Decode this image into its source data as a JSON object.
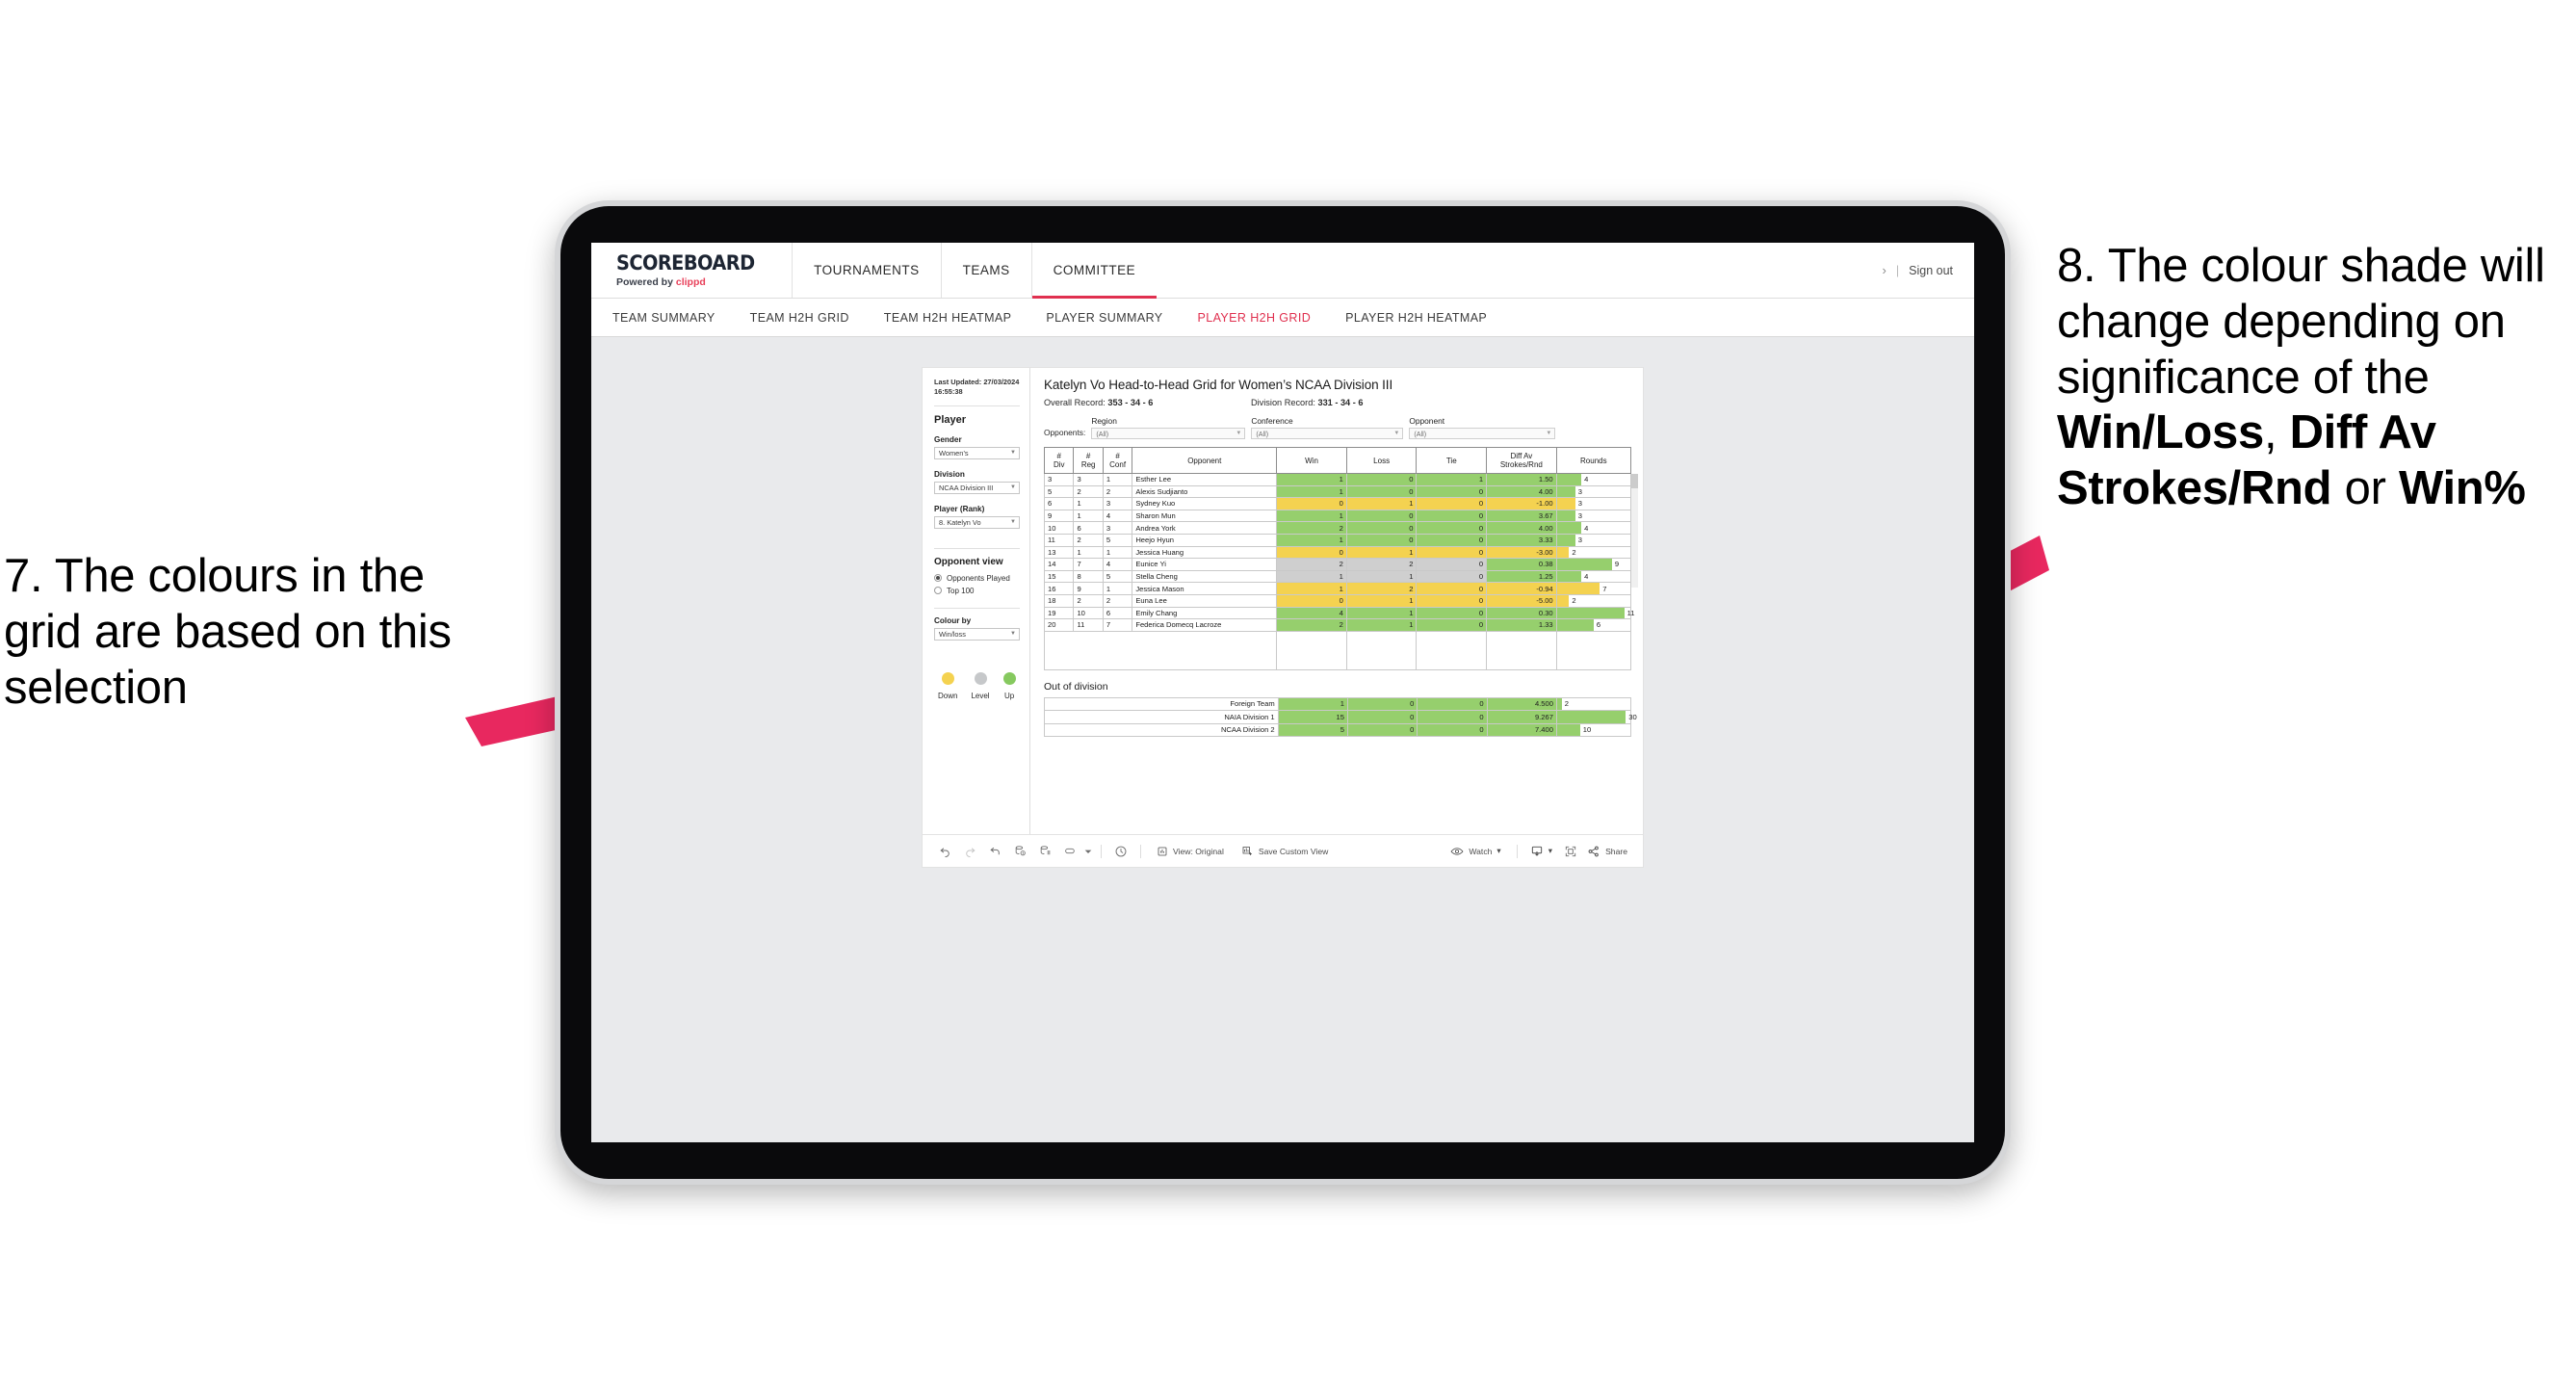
{
  "annotations": {
    "left": "7. The colours in the grid are based on this selection",
    "right_pre": "8. The colour shade will change depending on significance of the ",
    "right_b1": "Win/Loss",
    "right_mid1": ", ",
    "right_b2": "Diff Av Strokes/Rnd",
    "right_mid2": " or ",
    "right_b3": "Win%",
    "arrow_color": "#e8285f"
  },
  "header": {
    "brand_name": "SCOREBOARD",
    "brand_sub_prefix": "Powered by ",
    "brand_sub_clippd": "clippd",
    "tabs": [
      {
        "label": "TOURNAMENTS",
        "active": false
      },
      {
        "label": "TEAMS",
        "active": false
      },
      {
        "label": "COMMITTEE",
        "active": true
      }
    ],
    "chevron": "›",
    "separator": "|",
    "sign_out": "Sign out"
  },
  "subnav": {
    "items": [
      {
        "label": "TEAM SUMMARY",
        "active": false
      },
      {
        "label": "TEAM H2H GRID",
        "active": false
      },
      {
        "label": "TEAM H2H HEATMAP",
        "active": false
      },
      {
        "label": "PLAYER SUMMARY",
        "active": false
      },
      {
        "label": "PLAYER H2H GRID",
        "active": true
      },
      {
        "label": "PLAYER H2H HEATMAP",
        "active": false
      }
    ],
    "active_color": "#e0304f"
  },
  "panel": {
    "last_updated_line1": "Last Updated: 27/03/2024",
    "last_updated_line2": "16:55:38",
    "section_player": "Player",
    "fields": [
      {
        "label": "Gender",
        "value": "Women’s"
      },
      {
        "label": "Division",
        "value": "NCAA Division III"
      },
      {
        "label": "Player (Rank)",
        "value": "8. Katelyn Vo"
      }
    ],
    "opponent_view_title": "Opponent view",
    "opponent_view_options": [
      {
        "label": "Opponents Played",
        "selected": true
      },
      {
        "label": "Top 100",
        "selected": false
      }
    ],
    "colour_by_label": "Colour by",
    "colour_by_value": "Win/loss",
    "legend": [
      {
        "label": "Down",
        "color": "#f4d250"
      },
      {
        "label": "Level",
        "color": "#c6c8ca"
      },
      {
        "label": "Up",
        "color": "#86c95f"
      }
    ]
  },
  "main": {
    "title": "Katelyn Vo Head-to-Head Grid for Women’s NCAA Division III",
    "overall_record_label": "Overall Record: ",
    "overall_record_value": "353 -  34 - 6",
    "division_record_label": "Division Record: ",
    "division_record_value": "331 -  34 - 6",
    "opponents_label": "Opponents:",
    "filters": [
      {
        "caption": "Region",
        "value": "(All)"
      },
      {
        "caption": "Conference",
        "value": "(All)"
      },
      {
        "caption": "Opponent",
        "value": "(All)"
      }
    ],
    "out_of_division_title": "Out of division"
  },
  "chart_data": {
    "type": "table",
    "title": "Katelyn Vo Head-to-Head Grid for Women’s NCAA Division III",
    "columns": [
      "# Div",
      "# Reg",
      "# Conf",
      "Opponent",
      "Win",
      "Loss",
      "Tie",
      "Diff Av Strokes/Rnd",
      "Rounds"
    ],
    "column_headers_split": [
      {
        "l1": "#",
        "l2": "Div"
      },
      {
        "l1": "#",
        "l2": "Reg"
      },
      {
        "l1": "#",
        "l2": "Conf"
      },
      {
        "l1": "Opponent",
        "l2": ""
      },
      {
        "l1": "Win",
        "l2": ""
      },
      {
        "l1": "Loss",
        "l2": ""
      },
      {
        "l1": "Tie",
        "l2": ""
      },
      {
        "l1": "Diff Av",
        "l2": "Strokes/Rnd"
      },
      {
        "l1": "Rounds",
        "l2": ""
      }
    ],
    "rounds_max": 12,
    "rows": [
      {
        "div": "3",
        "reg": "3",
        "conf": "1",
        "opponent": "Esther Lee",
        "win": "1",
        "loss": "0",
        "tie": "1",
        "diff": "1.50",
        "rounds": 4,
        "shade": "green"
      },
      {
        "div": "5",
        "reg": "2",
        "conf": "2",
        "opponent": "Alexis Sudjianto",
        "win": "1",
        "loss": "0",
        "tie": "0",
        "diff": "4.00",
        "rounds": 3,
        "shade": "green"
      },
      {
        "div": "6",
        "reg": "1",
        "conf": "3",
        "opponent": "Sydney Kuo",
        "win": "0",
        "loss": "1",
        "tie": "0",
        "diff": "-1.00",
        "rounds": 3,
        "shade": "yellow"
      },
      {
        "div": "9",
        "reg": "1",
        "conf": "4",
        "opponent": "Sharon Mun",
        "win": "1",
        "loss": "0",
        "tie": "0",
        "diff": "3.67",
        "rounds": 3,
        "shade": "green"
      },
      {
        "div": "10",
        "reg": "6",
        "conf": "3",
        "opponent": "Andrea York",
        "win": "2",
        "loss": "0",
        "tie": "0",
        "diff": "4.00",
        "rounds": 4,
        "shade": "green"
      },
      {
        "div": "11",
        "reg": "2",
        "conf": "5",
        "opponent": "Heejo Hyun",
        "win": "1",
        "loss": "0",
        "tie": "0",
        "diff": "3.33",
        "rounds": 3,
        "shade": "green"
      },
      {
        "div": "13",
        "reg": "1",
        "conf": "1",
        "opponent": "Jessica Huang",
        "win": "0",
        "loss": "1",
        "tie": "0",
        "diff": "-3.00",
        "rounds": 2,
        "shade": "yellow"
      },
      {
        "div": "14",
        "reg": "7",
        "conf": "4",
        "opponent": "Eunice Yi",
        "win": "2",
        "loss": "2",
        "tie": "0",
        "diff": "0.38",
        "rounds": 9,
        "shade": "grey",
        "diff_shade": "green"
      },
      {
        "div": "15",
        "reg": "8",
        "conf": "5",
        "opponent": "Stella Cheng",
        "win": "1",
        "loss": "1",
        "tie": "0",
        "diff": "1.25",
        "rounds": 4,
        "shade": "grey",
        "diff_shade": "green"
      },
      {
        "div": "16",
        "reg": "9",
        "conf": "1",
        "opponent": "Jessica Mason",
        "win": "1",
        "loss": "2",
        "tie": "0",
        "diff": "-0.94",
        "rounds": 7,
        "shade": "yellow"
      },
      {
        "div": "18",
        "reg": "2",
        "conf": "2",
        "opponent": "Euna Lee",
        "win": "0",
        "loss": "1",
        "tie": "0",
        "diff": "-5.00",
        "rounds": 2,
        "shade": "yellow"
      },
      {
        "div": "19",
        "reg": "10",
        "conf": "6",
        "opponent": "Emily Chang",
        "win": "4",
        "loss": "1",
        "tie": "0",
        "diff": "0.30",
        "rounds": 11,
        "shade": "green"
      },
      {
        "div": "20",
        "reg": "11",
        "conf": "7",
        "opponent": "Federica Domecq Lacroze",
        "win": "2",
        "loss": "1",
        "tie": "0",
        "diff": "1.33",
        "rounds": 6,
        "shade": "green"
      }
    ],
    "out_of_division": {
      "title": "Out of division",
      "rounds_max": 32,
      "rows": [
        {
          "name": "Foreign Team",
          "win": "1",
          "loss": "0",
          "tie": "0",
          "diff": "4.500",
          "rounds": 2,
          "shade": "green"
        },
        {
          "name": "NAIA Division 1",
          "win": "15",
          "loss": "0",
          "tie": "0",
          "diff": "9.267",
          "rounds": 30,
          "shade": "green"
        },
        {
          "name": "NCAA Division 2",
          "win": "5",
          "loss": "0",
          "tie": "0",
          "diff": "7.400",
          "rounds": 10,
          "shade": "green"
        }
      ]
    },
    "colors": {
      "green": "#96cf6d",
      "yellow": "#f4d250",
      "grey": "#cfcfcf"
    }
  },
  "toolbar": {
    "view_label": "View: Original",
    "save_label": "Save Custom View",
    "watch_label": "Watch",
    "share_label": "Share",
    "caret": "▾"
  }
}
